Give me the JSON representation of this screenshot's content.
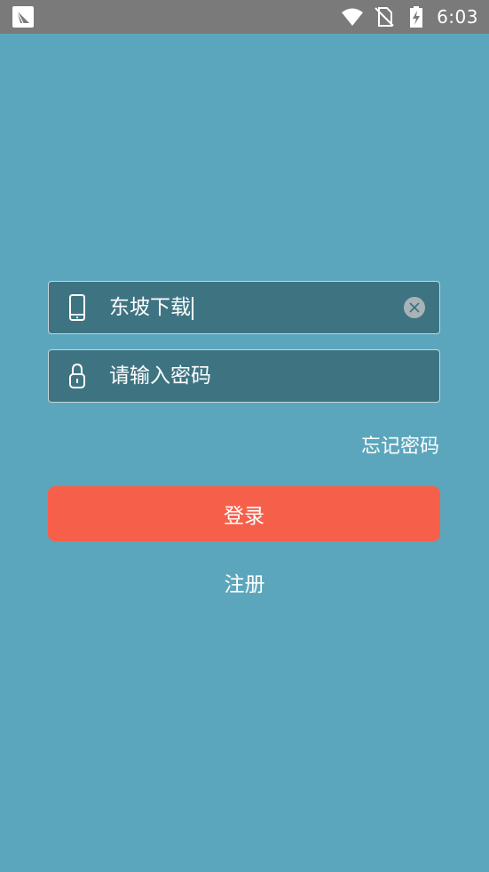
{
  "status_bar": {
    "time": "6:03",
    "icons": [
      "app-icon",
      "wifi-icon",
      "no-sim-icon",
      "battery-charging-icon"
    ]
  },
  "login_form": {
    "phone_field": {
      "value": "东坡下载",
      "icon": "phone-icon",
      "clear_icon": "clear-icon"
    },
    "password_field": {
      "placeholder": "请输入密码",
      "icon": "lock-icon"
    },
    "forgot_password_label": "忘记密码",
    "login_button_label": "登录",
    "register_label": "注册"
  },
  "colors": {
    "background": "#5ba6bc",
    "field_background": "#3e7482",
    "field_border": "#c9d6da",
    "login_button": "#f6604a",
    "status_bar": "#7a7a7a"
  }
}
